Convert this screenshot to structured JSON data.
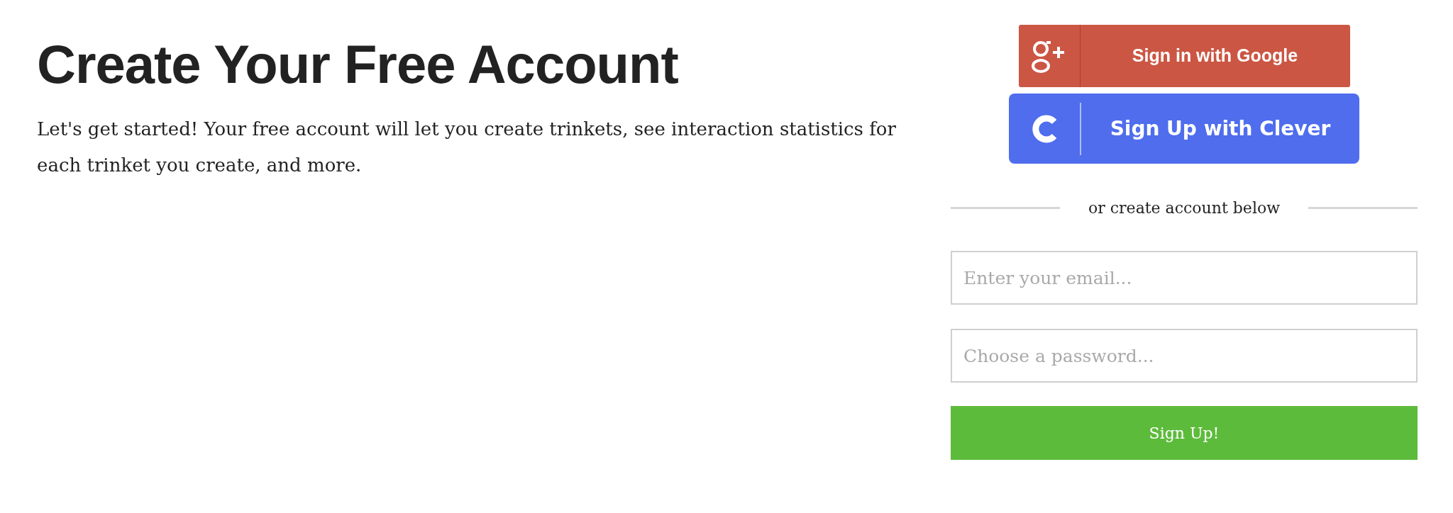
{
  "heading": "Create Your Free Account",
  "intro": "Let's get started! Your free account will let you create trinkets, see interaction statistics for each trinket you create, and more.",
  "social_buttons": [
    {
      "kind": "google",
      "label": "Sign in with Google"
    },
    {
      "kind": "clever",
      "label": "Sign Up with Clever"
    }
  ],
  "divider": "or create account below",
  "fields": [
    {
      "placeholder": "Enter your email..."
    },
    {
      "placeholder": "Choose a password..."
    }
  ],
  "submit": "Sign Up!"
}
